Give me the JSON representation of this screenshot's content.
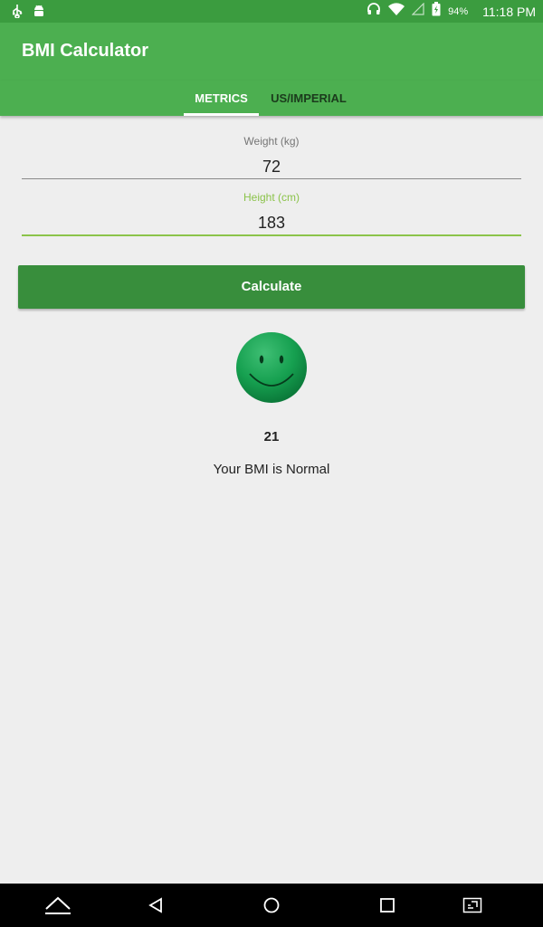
{
  "status_bar": {
    "battery": "94%",
    "time": "11:18 PM",
    "icons": [
      "usb-icon",
      "android-debug-icon",
      "headset-icon",
      "wifi-icon",
      "signal-icon",
      "battery-icon"
    ]
  },
  "app_bar": {
    "title": "BMI Calculator"
  },
  "tabs": [
    {
      "label": "METRICS",
      "selected": true
    },
    {
      "label": "US/IMPERIAL",
      "selected": false
    }
  ],
  "form": {
    "weight": {
      "label": "Weight (kg)",
      "value": "72"
    },
    "height": {
      "label": "Height (cm)",
      "value": "183"
    }
  },
  "calculate_button": {
    "label": "Calculate"
  },
  "result": {
    "icon": "smiley-face-icon",
    "bmi": "21",
    "status": "Your BMI is Normal"
  },
  "nav_bar": {
    "icons": [
      "keyboard-hide-icon",
      "back-icon",
      "home-icon",
      "recents-icon",
      "screen-cast-icon"
    ]
  },
  "colors": {
    "primary": "#4caf50",
    "primary_dark": "#388e3c",
    "accent": "#8bc34a",
    "background": "#eeeeee"
  }
}
